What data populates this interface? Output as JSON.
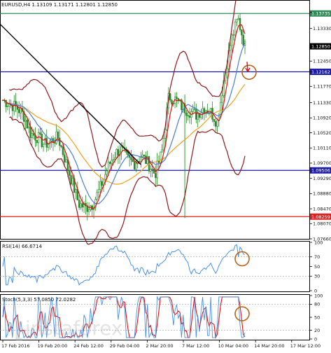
{
  "symbol_line": "EURUSD,H4  1.13109 1.13171 1.12801 1.12850",
  "price_axis": {
    "ticks": [
      "1.13770",
      "1.13330",
      "1.12850",
      "1.12450",
      "1.12162",
      "1.11770",
      "1.11330",
      "1.10920",
      "1.10520",
      "1.10110",
      "1.09700",
      "1.09290",
      "1.08880",
      "1.08470",
      "1.08070",
      "1.07660"
    ],
    "tick_values": [
      1.1377,
      1.1333,
      1.1285,
      1.1245,
      1.12162,
      1.1177,
      1.1133,
      1.1092,
      1.1052,
      1.1011,
      1.097,
      1.0929,
      1.0888,
      1.0847,
      1.0807,
      1.0766
    ],
    "range": [
      1.0766,
      1.1406
    ]
  },
  "levels": [
    {
      "value": 1.13735,
      "label": "1.13735",
      "color": "#2e8b57"
    },
    {
      "value": 1.12162,
      "label": "1.12162",
      "color": "#1a1aa8"
    },
    {
      "value": 1.09506,
      "label": "1.09506",
      "color": "#1a1aa8"
    },
    {
      "value": 1.08259,
      "label": "1.08259",
      "color": "#e02020"
    }
  ],
  "current_price": {
    "value": 1.1285,
    "label": "1.12850"
  },
  "rsi": {
    "title": "RSI(14) 66.6714",
    "ticks": [
      "100",
      "70",
      "50",
      "30",
      "0"
    ],
    "tick_values": [
      100,
      70,
      50,
      30,
      0
    ],
    "levels": [
      70,
      30
    ]
  },
  "stoch": {
    "title": "Stoch(5,3,3) 57.0850 72.0282",
    "ticks": [
      "100",
      "80",
      "50",
      "20",
      "0"
    ],
    "tick_values": [
      100,
      80,
      50,
      20,
      0
    ],
    "levels": [
      80,
      20
    ]
  },
  "time_axis": {
    "labels": [
      "17 Feb 2016",
      "19 Feb 20:00",
      "24 Feb 12:00",
      "29 Feb 04:00",
      "2 Mar 20:00",
      "7 Mar 12:00",
      "10 Mar 04:00",
      "14 Mar 20:00",
      "17 Mar 12:00"
    ]
  },
  "watermark": "instaforex",
  "colors": {
    "candles": "#2a8a2a",
    "bollinger": "#8b1a1a",
    "ma_red": "#e01010",
    "ma_blue": "#4a7fd0",
    "ma_orange": "#f0a020",
    "trendline": "#000000",
    "rsi_line": "#4a90e2",
    "stoch_main": "#4a90e2",
    "stoch_signal": "#e01010",
    "annotation": "#b5651d"
  },
  "chart_data": {
    "type": "line",
    "title": "EURUSD,H4",
    "series": [
      {
        "name": "EURUSD",
        "x": [
          0,
          10,
          20,
          30,
          40,
          50,
          60,
          70,
          80,
          90,
          100,
          110,
          120,
          130,
          140,
          150,
          160,
          170,
          180,
          190,
          200,
          210,
          220,
          230,
          240,
          250,
          260,
          270,
          280,
          290,
          300,
          310,
          320,
          330,
          340,
          350
        ],
        "values": [
          1.114,
          1.113,
          1.112,
          1.11,
          1.105,
          1.104,
          1.102,
          1.103,
          1.104,
          1.098,
          1.092,
          1.086,
          1.085,
          1.086,
          1.09,
          1.095,
          1.099,
          1.101,
          1.098,
          1.097,
          1.099,
          1.097,
          1.094,
          1.1,
          1.115,
          1.114,
          1.112,
          1.111,
          1.11,
          1.112,
          1.111,
          1.108,
          1.12,
          1.13,
          1.136,
          1.1285
        ]
      }
    ],
    "xlabel": "",
    "ylabel": "",
    "ylim": [
      1.0766,
      1.1406
    ]
  }
}
